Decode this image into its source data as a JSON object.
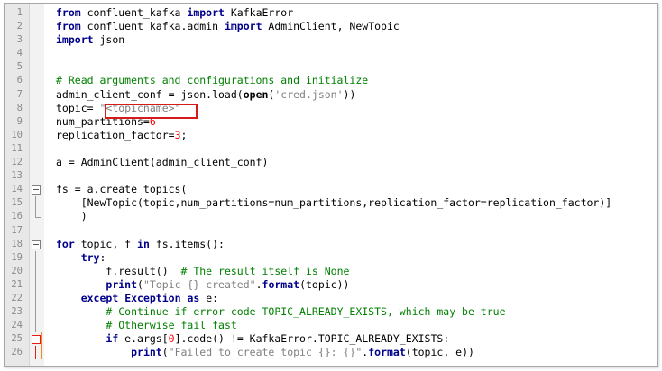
{
  "editor": {
    "lines": [
      {
        "num": "1",
        "parts": [
          {
            "t": "from",
            "c": "kw"
          },
          {
            "t": " confluent_kafka ",
            "c": ""
          },
          {
            "t": "import",
            "c": "kw"
          },
          {
            "t": " KafkaError",
            "c": ""
          }
        ]
      },
      {
        "num": "2",
        "parts": [
          {
            "t": "from",
            "c": "kw"
          },
          {
            "t": " confluent_kafka.admin ",
            "c": ""
          },
          {
            "t": "import",
            "c": "kw"
          },
          {
            "t": " AdminClient, NewTopic",
            "c": ""
          }
        ]
      },
      {
        "num": "3",
        "parts": [
          {
            "t": "import",
            "c": "kw"
          },
          {
            "t": " json",
            "c": ""
          }
        ]
      },
      {
        "num": "4",
        "parts": []
      },
      {
        "num": "5",
        "parts": []
      },
      {
        "num": "6",
        "parts": [
          {
            "t": "# Read arguments and configurations and initialize",
            "c": "cm"
          }
        ]
      },
      {
        "num": "7",
        "parts": [
          {
            "t": "admin_client_conf = json.load(",
            "c": ""
          },
          {
            "t": "open",
            "c": "fn"
          },
          {
            "t": "(",
            "c": ""
          },
          {
            "t": "'cred.json'",
            "c": "str"
          },
          {
            "t": "))",
            "c": ""
          }
        ]
      },
      {
        "num": "8",
        "parts": [
          {
            "t": "topic= ",
            "c": ""
          },
          {
            "t": "\"<topicname>\"",
            "c": "str"
          }
        ]
      },
      {
        "num": "9",
        "parts": [
          {
            "t": "num_partitions=",
            "c": ""
          },
          {
            "t": "6",
            "c": "num"
          }
        ]
      },
      {
        "num": "10",
        "parts": [
          {
            "t": "replication_factor=",
            "c": ""
          },
          {
            "t": "3",
            "c": "num"
          },
          {
            "t": ";",
            "c": ""
          }
        ]
      },
      {
        "num": "11",
        "parts": []
      },
      {
        "num": "12",
        "parts": [
          {
            "t": "a = AdminClient(admin_client_conf)",
            "c": ""
          }
        ]
      },
      {
        "num": "13",
        "parts": []
      },
      {
        "num": "14",
        "parts": [
          {
            "t": "fs = a.create_topics(",
            "c": ""
          }
        ]
      },
      {
        "num": "15",
        "parts": [
          {
            "t": "    [NewTopic(topic,num_partitions=num_partitions,replication_factor=replication_factor)]",
            "c": ""
          }
        ]
      },
      {
        "num": "16",
        "parts": [
          {
            "t": "    )",
            "c": ""
          }
        ]
      },
      {
        "num": "17",
        "parts": []
      },
      {
        "num": "18",
        "parts": [
          {
            "t": "for",
            "c": "kw"
          },
          {
            "t": " topic, f ",
            "c": ""
          },
          {
            "t": "in",
            "c": "kw"
          },
          {
            "t": " fs.items():",
            "c": ""
          }
        ]
      },
      {
        "num": "19",
        "parts": [
          {
            "t": "    ",
            "c": ""
          },
          {
            "t": "try",
            "c": "kw"
          },
          {
            "t": ":",
            "c": ""
          }
        ]
      },
      {
        "num": "20",
        "parts": [
          {
            "t": "        f.result()  ",
            "c": ""
          },
          {
            "t": "# The result itself is None",
            "c": "cm"
          }
        ]
      },
      {
        "num": "21",
        "parts": [
          {
            "t": "        ",
            "c": ""
          },
          {
            "t": "print",
            "c": "kw"
          },
          {
            "t": "(",
            "c": ""
          },
          {
            "t": "\"Topic {} created\"",
            "c": "str"
          },
          {
            "t": ".",
            "c": ""
          },
          {
            "t": "format",
            "c": "kw"
          },
          {
            "t": "(topic))",
            "c": ""
          }
        ]
      },
      {
        "num": "22",
        "parts": [
          {
            "t": "    ",
            "c": ""
          },
          {
            "t": "except",
            "c": "kw"
          },
          {
            "t": " ",
            "c": ""
          },
          {
            "t": "Exception",
            "c": "kw"
          },
          {
            "t": " ",
            "c": ""
          },
          {
            "t": "as",
            "c": "kw"
          },
          {
            "t": " e:",
            "c": ""
          }
        ]
      },
      {
        "num": "23",
        "parts": [
          {
            "t": "        ",
            "c": ""
          },
          {
            "t": "# Continue if error code TOPIC_ALREADY_EXISTS, which may be true",
            "c": "cm"
          }
        ]
      },
      {
        "num": "24",
        "parts": [
          {
            "t": "        ",
            "c": ""
          },
          {
            "t": "# Otherwise fail fast",
            "c": "cm"
          }
        ]
      },
      {
        "num": "25",
        "parts": [
          {
            "t": "        ",
            "c": ""
          },
          {
            "t": "if",
            "c": "kw"
          },
          {
            "t": " e.args[",
            "c": ""
          },
          {
            "t": "0",
            "c": "num"
          },
          {
            "t": "].code() != KafkaError.TOPIC_ALREADY_EXISTS:",
            "c": ""
          }
        ]
      },
      {
        "num": "26",
        "parts": [
          {
            "t": "            ",
            "c": ""
          },
          {
            "t": "print",
            "c": "kw"
          },
          {
            "t": "(",
            "c": ""
          },
          {
            "t": "\"Failed to create topic {}: {}\"",
            "c": "str"
          },
          {
            "t": ".",
            "c": ""
          },
          {
            "t": "format",
            "c": "kw"
          },
          {
            "t": "(topic, e))",
            "c": ""
          }
        ]
      }
    ]
  }
}
